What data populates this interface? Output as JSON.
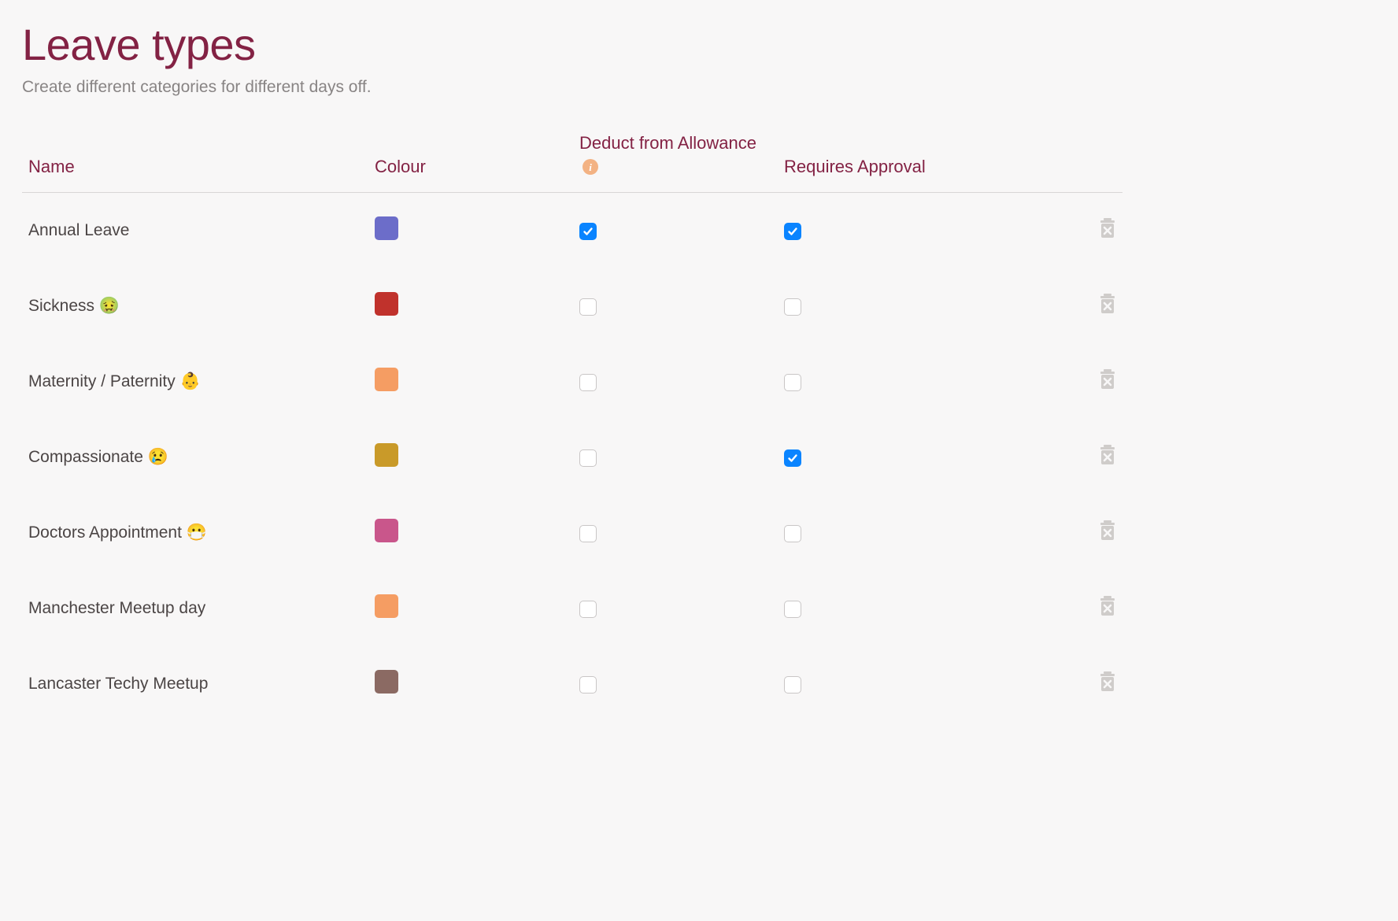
{
  "page": {
    "title": "Leave types",
    "subtitle": "Create different categories for different days off."
  },
  "table": {
    "headers": {
      "name": "Name",
      "colour": "Colour",
      "deduct": "Deduct from Allowance",
      "approval": "Requires Approval"
    },
    "rows": [
      {
        "name": "Annual Leave",
        "colour": "#6c6dc9",
        "deduct": true,
        "approval": true
      },
      {
        "name": "Sickness 🤢",
        "colour": "#c0322c",
        "deduct": false,
        "approval": false
      },
      {
        "name": "Maternity / Paternity 👶",
        "colour": "#f59d63",
        "deduct": false,
        "approval": false
      },
      {
        "name": "Compassionate 😢",
        "colour": "#c99a29",
        "deduct": false,
        "approval": true
      },
      {
        "name": "Doctors Appointment 😷",
        "colour": "#c9568b",
        "deduct": false,
        "approval": false
      },
      {
        "name": "Manchester Meetup day",
        "colour": "#f59d63",
        "deduct": false,
        "approval": false
      },
      {
        "name": "Lancaster Techy Meetup",
        "colour": "#8b6a63",
        "deduct": false,
        "approval": false
      }
    ]
  }
}
